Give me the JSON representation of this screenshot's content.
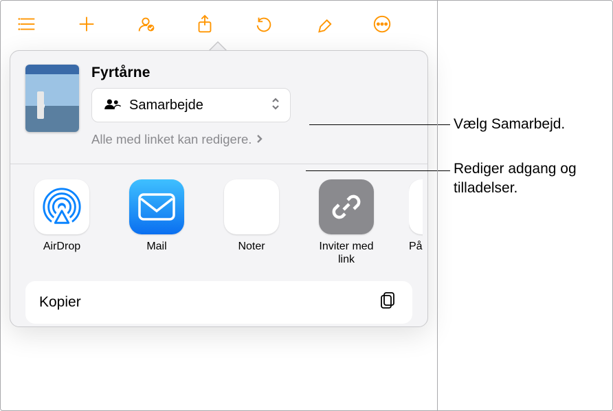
{
  "toolbar": {
    "buttons": [
      "sidebar",
      "add",
      "collaborate",
      "share",
      "undo",
      "format",
      "more"
    ]
  },
  "sheet": {
    "doc_title": "Fyrtårne",
    "collab_label": "Samarbejde",
    "permission_text": "Alle med linket kan redigere.",
    "apps": [
      {
        "id": "airdrop",
        "label": "AirDrop"
      },
      {
        "id": "mail",
        "label": "Mail"
      },
      {
        "id": "notes",
        "label": "Noter"
      },
      {
        "id": "invite",
        "label": "Inviter med link"
      },
      {
        "id": "reminders",
        "label": "Påm"
      }
    ],
    "copy_label": "Kopier"
  },
  "callouts": {
    "c1": "Vælg Samarbejd.",
    "c2": "Rediger adgang og tilladelser."
  }
}
